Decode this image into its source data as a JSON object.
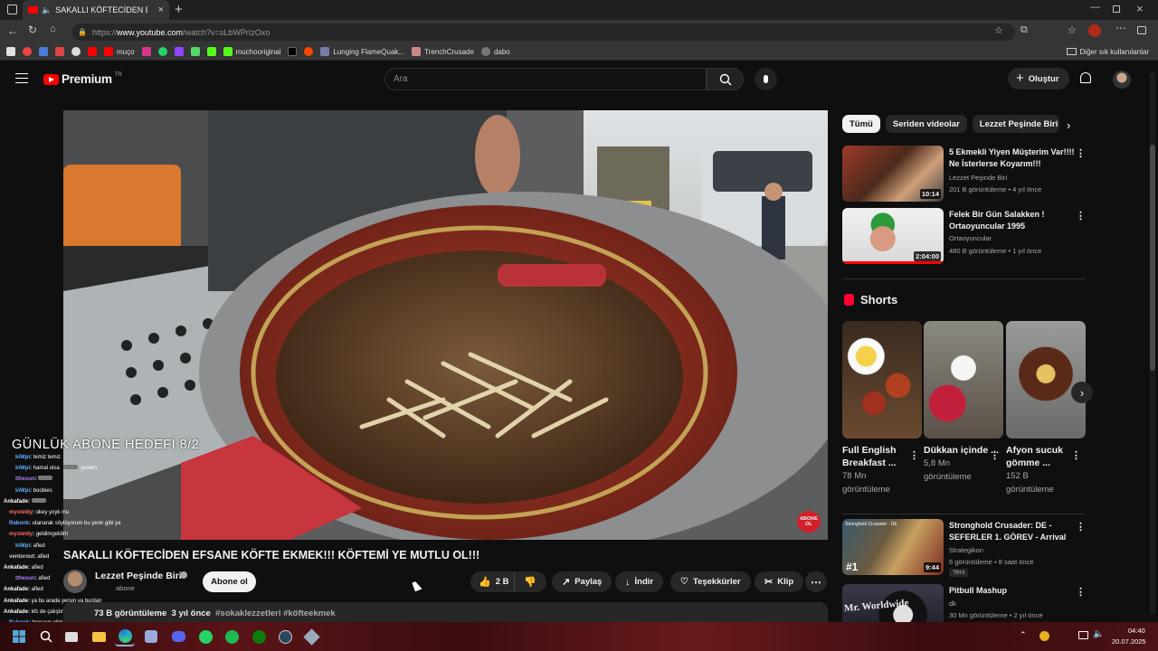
{
  "browser": {
    "tab_title": "SAKALLI KÖFTECİDEN EFSANE",
    "url_prefix": "https://",
    "url_host": "www.youtube.com",
    "url_path": "/watch?v=sLbWPrIzOxo",
    "bookmarks": [
      "muço",
      "muchooriginal",
      "Lunging FlameQuak...",
      "TrenchCrusade",
      "dabo"
    ],
    "other_bookmarks": "Diğer sık kullanılanlar"
  },
  "youtube": {
    "logo": "Premium",
    "logo_badge": "TR",
    "search_placeholder": "Ara",
    "create_label": "Oluştur"
  },
  "video": {
    "overlay_goal": "GÜNLÜK ABONE HEDEFİ 8/2",
    "corner_badge_top": "ABONE",
    "corner_badge_bottom": "OL",
    "title": "SAKALLI KÖFTECİDEN EFSANE KÖFTE EKMEK!!! KÖFTEMİ YE MUTLU OL!!!",
    "channel": "Lezzet Peşinde Biri",
    "channel_sub_text": "abone",
    "subscribe_label": "Abone ol",
    "likes": "2 B",
    "share_label": "Paylaş",
    "download_label": "İndir",
    "thanks_label": "Teşekkürler",
    "clip_label": "Klip",
    "desc_views": "73 B görüntüleme",
    "desc_date": "3 yıl önce",
    "desc_tags": "#sokaklezzetleri #köfteekmek"
  },
  "chat": [
    {
      "user": "kiWpi",
      "msg": "temiz temiz",
      "color": "#5fb0ff"
    },
    {
      "user": "kiWpi",
      "msg": "hamal olsa",
      "color": "#5fb0ff",
      "extra": "yesem"
    },
    {
      "user": "tthesun",
      "msg": "",
      "color": "#b07cff"
    },
    {
      "user": "kiWpi",
      "msg": "boobies",
      "color": "#5fb0ff"
    },
    {
      "user": "Ankafade",
      "msg": "",
      "color": "#ffffff"
    },
    {
      "user": "mysteldy",
      "msg": "okey yoyk mu",
      "color": "#ff6b6b"
    },
    {
      "user": "Rabonk",
      "msg": "utanarak söylüyorum bu yenir gibi ya",
      "color": "#6ba3ff"
    },
    {
      "user": "mysteldy",
      "msg": "geldimgeldim",
      "color": "#ff6b6b"
    },
    {
      "user": "kiWpi",
      "msg": "afied",
      "color": "#5fb0ff"
    },
    {
      "user": "ventorout",
      "msg": "afied",
      "color": "#d0d0d0"
    },
    {
      "user": "Ankafade",
      "msg": "afied",
      "color": "#ffffff"
    },
    {
      "user": "tthesun",
      "msg": "afied",
      "color": "#b07cff"
    },
    {
      "user": "Ankafade",
      "msg": "afied",
      "color": "#ffffff"
    },
    {
      "user": "Ankafade",
      "msg": "ya bu arada yersin ya burdan",
      "color": "#ffffff"
    },
    {
      "user": "Ankafade",
      "msg": "kfc de çalıştım ortam yarrak gibiydi şapur şupur yeniliyor",
      "color": "#ffffff"
    },
    {
      "user": "Rabonk",
      "msg": "herşeye elini sokmasa bide",
      "color": "#6ba3ff"
    }
  ],
  "sidebar": {
    "chips": [
      "Tümü",
      "Seriden videolar",
      "Lezzet Peşinde Biri e"
    ],
    "recommendations_top": [
      {
        "title": "5 Ekmekli Yiyen Müşterim Var!!!! Ne İsterlerse Koyarım!!!",
        "channel": "Lezzet Peşinde Biri",
        "meta": "201 B görüntüleme • 4 yıl önce",
        "duration": "10:14"
      },
      {
        "title": "Felek Bir Gün Salakken ! Ortaoyuncular 1995",
        "channel": "Ortaoyuncular",
        "meta": "480 B görüntüleme • 1 yıl önce",
        "duration": "2:04:00"
      }
    ],
    "shorts_title": "Shorts",
    "shorts": [
      {
        "title": "Full English Breakfast ...",
        "views": "78 Mn",
        "views_label": "görüntüleme"
      },
      {
        "title": "Dükkan içinde ...",
        "views": "5,8 Mn",
        "views_label": "görüntüleme"
      },
      {
        "title": "Afyon sucuk gömme ...",
        "views": "152 B",
        "views_label": "görüntüleme"
      }
    ],
    "recommendations_bottom": [
      {
        "title": "Stronghold Crusader: DE - SEFERLER 1. GÖREV - Arrival",
        "channel": "Strategikon",
        "meta": "6 görüntüleme • 8 saat önce",
        "badge": "Yeni",
        "duration": "9:44",
        "thumb_text_top": "Stronghold Crusader - DE",
        "thumb_text_bottom": "#1"
      },
      {
        "title": "Pitbull Mashup",
        "channel": "dk",
        "meta": "30 Mn görüntüleme • 2 yıl önce",
        "thumb_text_top": "Mr. Worldwide"
      }
    ]
  },
  "taskbar": {
    "time": "04:40",
    "date": "20.07.2025"
  }
}
